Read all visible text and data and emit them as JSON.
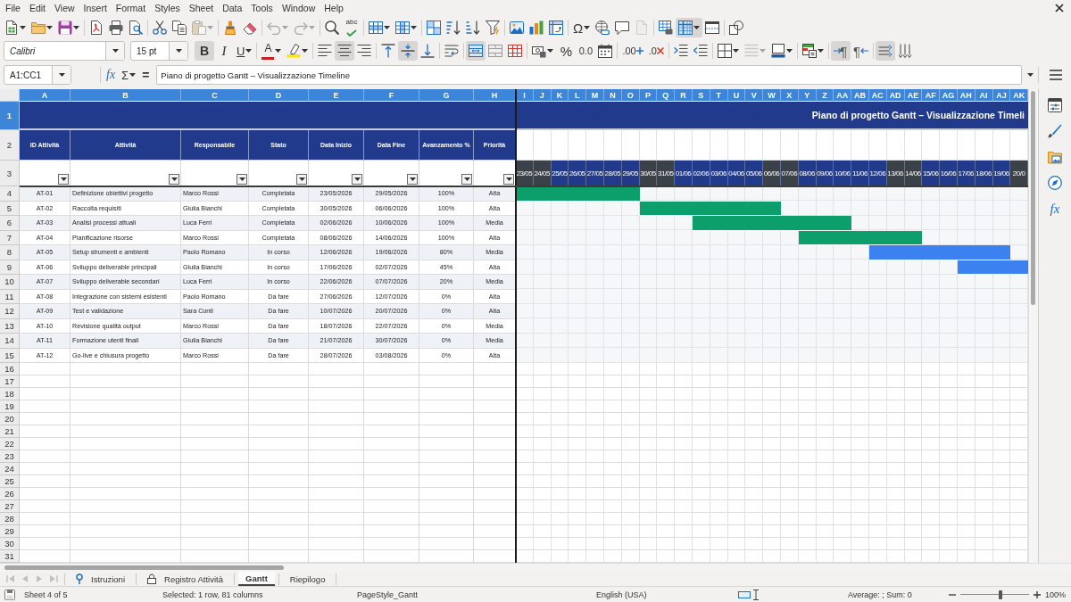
{
  "menu": [
    "File",
    "Edit",
    "View",
    "Insert",
    "Format",
    "Styles",
    "Sheet",
    "Data",
    "Tools",
    "Window",
    "Help"
  ],
  "standard_toolbar": [
    {
      "active": false,
      "disabled": false
    },
    {
      "active": false,
      "disabled": false
    },
    {
      "active": false,
      "disabled": false
    },
    {
      "active": false,
      "disabled": false
    },
    {
      "active": false,
      "disabled": false
    },
    {
      "active": false,
      "disabled": false
    },
    {
      "active": false,
      "disabled": false
    },
    {
      "active": false,
      "disabled": false
    },
    {
      "active": false,
      "disabled": true
    },
    {
      "active": false,
      "disabled": false
    },
    {
      "active": false,
      "disabled": false
    },
    {
      "active": false,
      "disabled": true
    },
    {
      "active": false,
      "disabled": true
    },
    {
      "active": false,
      "disabled": false
    },
    {
      "label": "abc",
      "active": false,
      "disabled": false
    },
    {
      "active": false,
      "disabled": false
    },
    {
      "active": false,
      "disabled": false
    },
    {
      "active": false,
      "disabled": false
    },
    {
      "active": false,
      "disabled": false
    },
    {
      "active": false,
      "disabled": false
    },
    {
      "active": false,
      "disabled": false
    },
    {
      "active": false,
      "disabled": false
    },
    {
      "active": false,
      "disabled": false
    },
    {
      "active": false,
      "disabled": false
    },
    {
      "label": "Ω",
      "active": false,
      "disabled": false
    },
    {
      "active": false,
      "disabled": false
    },
    {
      "active": false,
      "disabled": false
    },
    {
      "active": false,
      "disabled": true
    },
    {
      "active": false,
      "disabled": false
    },
    {
      "active": true,
      "disabled": false
    },
    {
      "active": false,
      "disabled": false
    },
    {
      "active": false,
      "disabled": false
    }
  ],
  "formatting_toolbar": {
    "font_name": "Calibri",
    "font_size": "15 pt",
    "buttons": [
      {
        "label": "B",
        "active": true,
        "disabled": false
      },
      {
        "label": "I",
        "active": false,
        "disabled": false
      },
      {
        "label": "U",
        "active": false,
        "disabled": false
      },
      {
        "label": "A",
        "active": false,
        "disabled": false
      },
      {
        "active": false,
        "disabled": false
      },
      {
        "active": false,
        "disabled": false
      },
      {
        "active": true,
        "disabled": false
      },
      {
        "active": false,
        "disabled": false
      },
      {
        "active": false,
        "disabled": false
      },
      {
        "active": true,
        "disabled": false
      },
      {
        "active": false,
        "disabled": false
      },
      {
        "active": false,
        "disabled": false
      },
      {
        "active": true,
        "disabled": false
      },
      {
        "active": false,
        "disabled": false
      },
      {
        "active": false,
        "disabled": false
      },
      {
        "active": false,
        "disabled": false
      },
      {
        "label": "%",
        "active": false,
        "disabled": false
      },
      {
        "label": "0.0",
        "active": false,
        "disabled": false
      },
      {
        "active": false,
        "disabled": false
      },
      {
        "label": ".00",
        "active": false,
        "disabled": false
      },
      {
        "label": ".0",
        "active": false,
        "disabled": false
      },
      {
        "active": false,
        "disabled": false
      },
      {
        "active": false,
        "disabled": false
      },
      {
        "active": false,
        "disabled": false
      },
      {
        "active": false,
        "disabled": true
      },
      {
        "active": false,
        "disabled": false
      },
      {
        "active": false,
        "disabled": false
      },
      {
        "label": "¶",
        "active": true,
        "disabled": false
      },
      {
        "label": "¶",
        "active": false,
        "disabled": false
      },
      {
        "active": true,
        "disabled": false
      },
      {
        "active": false,
        "disabled": false
      }
    ]
  },
  "formula_bar": {
    "name_box": "A1:CC1",
    "buttons": [
      {
        "label": "fx"
      },
      {
        "label": "Σ"
      },
      {
        "label": "="
      }
    ],
    "formula": "Piano di progetto Gantt – Visualizzazione Timeline"
  },
  "sheet": {
    "columns": [
      {
        "label": "A",
        "selected": true
      },
      {
        "label": "B",
        "selected": true
      },
      {
        "label": "C",
        "selected": true
      },
      {
        "label": "D",
        "selected": true
      },
      {
        "label": "E",
        "selected": true
      },
      {
        "label": "F",
        "selected": true
      },
      {
        "label": "G",
        "selected": true
      },
      {
        "label": "H",
        "selected": true
      },
      {
        "label": "I",
        "selected": true
      },
      {
        "label": "J",
        "selected": true
      },
      {
        "label": "K",
        "selected": true
      },
      {
        "label": "L",
        "selected": true
      },
      {
        "label": "M",
        "selected": true
      },
      {
        "label": "N",
        "selected": true
      },
      {
        "label": "O",
        "selected": true
      },
      {
        "label": "P",
        "selected": true
      },
      {
        "label": "Q",
        "selected": true
      },
      {
        "label": "R",
        "selected": true
      },
      {
        "label": "S",
        "selected": true
      },
      {
        "label": "T",
        "selected": true
      },
      {
        "label": "U",
        "selected": true
      },
      {
        "label": "V",
        "selected": true
      },
      {
        "label": "W",
        "selected": true
      },
      {
        "label": "X",
        "selected": true
      },
      {
        "label": "Y",
        "selected": true
      },
      {
        "label": "Z",
        "selected": true
      },
      {
        "label": "AA",
        "selected": true
      },
      {
        "label": "AB",
        "selected": true
      },
      {
        "label": "AC",
        "selected": true
      },
      {
        "label": "AD",
        "selected": true
      },
      {
        "label": "AE",
        "selected": true
      },
      {
        "label": "AF",
        "selected": true
      },
      {
        "label": "AG",
        "selected": true
      },
      {
        "label": "AH",
        "selected": true
      },
      {
        "label": "AI",
        "selected": true
      },
      {
        "label": "AJ",
        "selected": true
      },
      {
        "label": "AK",
        "selected": true
      }
    ],
    "rows": [
      {
        "label": "1",
        "selected": true
      },
      {
        "label": "2",
        "selected": false
      },
      {
        "label": "3",
        "selected": false
      },
      {
        "label": "4",
        "selected": false
      },
      {
        "label": "5",
        "selected": false
      },
      {
        "label": "6",
        "selected": false
      },
      {
        "label": "7",
        "selected": false
      },
      {
        "label": "8",
        "selected": false
      },
      {
        "label": "9",
        "selected": false
      },
      {
        "label": "10",
        "selected": false
      },
      {
        "label": "11",
        "selected": false
      },
      {
        "label": "12",
        "selected": false
      },
      {
        "label": "13",
        "selected": false
      },
      {
        "label": "14",
        "selected": false
      },
      {
        "label": "15",
        "selected": false
      },
      {
        "label": "16",
        "selected": false
      },
      {
        "label": "17",
        "selected": false
      },
      {
        "label": "18",
        "selected": false
      },
      {
        "label": "19",
        "selected": false
      },
      {
        "label": "20",
        "selected": false
      },
      {
        "label": "21",
        "selected": false
      },
      {
        "label": "22",
        "selected": false
      },
      {
        "label": "23",
        "selected": false
      },
      {
        "label": "24",
        "selected": false
      },
      {
        "label": "25",
        "selected": false
      },
      {
        "label": "26",
        "selected": false
      },
      {
        "label": "27",
        "selected": false
      },
      {
        "label": "28",
        "selected": false
      },
      {
        "label": "29",
        "selected": false
      },
      {
        "label": "30",
        "selected": false
      },
      {
        "label": "31",
        "selected": false
      }
    ],
    "title": "Piano di progetto Gantt – Visualizzazione Timeli",
    "headings": [
      "ID Attività",
      "Attività",
      "Responsabile",
      "Stato",
      "Data Inizio",
      "Data Fine",
      "Avanzamento %",
      "Priorità"
    ],
    "autofilter": true,
    "timeline": [
      {
        "label": "23/05",
        "weekend": true
      },
      {
        "label": "24/05",
        "weekend": true
      },
      {
        "label": "25/05",
        "weekend": false
      },
      {
        "label": "26/05",
        "weekend": false
      },
      {
        "label": "27/05",
        "weekend": false
      },
      {
        "label": "28/05",
        "weekend": false
      },
      {
        "label": "29/05",
        "weekend": false
      },
      {
        "label": "30/05",
        "weekend": true
      },
      {
        "label": "31/05",
        "weekend": true
      },
      {
        "label": "01/06",
        "weekend": false
      },
      {
        "label": "02/06",
        "weekend": false
      },
      {
        "label": "03/06",
        "weekend": false
      },
      {
        "label": "04/06",
        "weekend": false
      },
      {
        "label": "05/06",
        "weekend": false
      },
      {
        "label": "06/06",
        "weekend": true
      },
      {
        "label": "07/06",
        "weekend": true
      },
      {
        "label": "08/06",
        "weekend": false
      },
      {
        "label": "09/06",
        "weekend": false
      },
      {
        "label": "10/06",
        "weekend": false
      },
      {
        "label": "11/06",
        "weekend": false
      },
      {
        "label": "12/06",
        "weekend": false
      },
      {
        "label": "13/06",
        "weekend": true
      },
      {
        "label": "14/06",
        "weekend": true
      },
      {
        "label": "15/06",
        "weekend": false
      },
      {
        "label": "16/06",
        "weekend": false
      },
      {
        "label": "17/06",
        "weekend": false
      },
      {
        "label": "18/06",
        "weekend": false
      },
      {
        "label": "19/06",
        "weekend": false
      },
      {
        "label": "20/0",
        "weekend": true
      }
    ],
    "tasks": [
      {
        "cells": [
          "AT-01",
          "Definizione obiettivi progetto",
          "Marco Rossi",
          "Completata",
          "23/05/2026",
          "29/05/2026",
          "100%",
          "Alta"
        ],
        "color": "#0c9e6b"
      },
      {
        "cells": [
          "AT-02",
          "Raccolta requisiti",
          "Giulia Bianchi",
          "Completata",
          "30/05/2026",
          "06/06/2026",
          "100%",
          "Alta"
        ],
        "color": "#0c9e6b"
      },
      {
        "cells": [
          "AT-03",
          "Analisi processi attuali",
          "Luca Ferri",
          "Completata",
          "02/06/2026",
          "10/06/2026",
          "100%",
          "Media"
        ],
        "color": "#0c9e6b"
      },
      {
        "cells": [
          "AT-04",
          "Pianificazione risorse",
          "Marco Rossi",
          "Completata",
          "08/06/2026",
          "14/06/2026",
          "100%",
          "Alta"
        ],
        "color": "#0c9e6b"
      },
      {
        "cells": [
          "AT-05",
          "Setup strumenti e ambienti",
          "Paolo Romano",
          "In corso",
          "12/06/2026",
          "19/06/2026",
          "80%",
          "Media"
        ],
        "color": "#3b82f0"
      },
      {
        "cells": [
          "AT-06",
          "Sviluppo deliverable principali",
          "Giulia Bianchi",
          "In corso",
          "17/06/2026",
          "02/07/2026",
          "45%",
          "Alta"
        ],
        "color": "#3b82f0"
      },
      {
        "cells": [
          "AT-07",
          "Sviluppo deliverable secondari",
          "Luca Ferri",
          "In corso",
          "22/06/2026",
          "07/07/2026",
          "20%",
          "Media"
        ]
      },
      {
        "cells": [
          "AT-08",
          "Integrazione con sistemi esistenti",
          "Paolo Romano",
          "Da fare",
          "27/06/2026",
          "12/07/2026",
          "0%",
          "Alta"
        ]
      },
      {
        "cells": [
          "AT-09",
          "Test e validazione",
          "Sara Conti",
          "Da fare",
          "10/07/2026",
          "20/07/2026",
          "0%",
          "Alta"
        ]
      },
      {
        "cells": [
          "AT-10",
          "Revisione qualità output",
          "Marco Rossi",
          "Da fare",
          "18/07/2026",
          "22/07/2026",
          "0%",
          "Media"
        ]
      },
      {
        "cells": [
          "AT-11",
          "Formazione utenti finali",
          "Giulia Bianchi",
          "Da fare",
          "21/07/2026",
          "30/07/2026",
          "0%",
          "Media"
        ]
      },
      {
        "cells": [
          "AT-12",
          "Go-live e chiusura progetto",
          "Marco Rossi",
          "Da fare",
          "28/07/2026",
          "03/08/2026",
          "0%",
          "Alta"
        ]
      }
    ]
  },
  "sidebar": [
    {
      "selected": false
    },
    {
      "selected": false
    },
    {
      "selected": false
    },
    {
      "selected": false
    },
    {
      "label": "fx",
      "selected": false
    }
  ],
  "sheet_tabs": {
    "navigation": [
      {
        "disabled": true
      },
      {
        "disabled": true
      },
      {
        "disabled": true
      },
      {
        "disabled": true
      }
    ],
    "tabs": [
      {
        "label": "Istruzioni",
        "kind": "pinned",
        "selected": false
      },
      {
        "label": "Registro Attività",
        "kind": "locked",
        "selected": false
      },
      {
        "label": "Gantt",
        "kind": "plain",
        "selected": true
      },
      {
        "label": "Riepilogo",
        "kind": "plain",
        "selected": false
      }
    ]
  },
  "status_bar": {
    "sheet": "Sheet 4 of 5",
    "selection": "Selected: 1 row, 81 columns",
    "page_style": "PageStyle_Gantt",
    "language": "English (USA)",
    "summary": "Average: ; Sum: 0",
    "zoom": {
      "level": 0.58,
      "reading": "100%"
    }
  }
}
